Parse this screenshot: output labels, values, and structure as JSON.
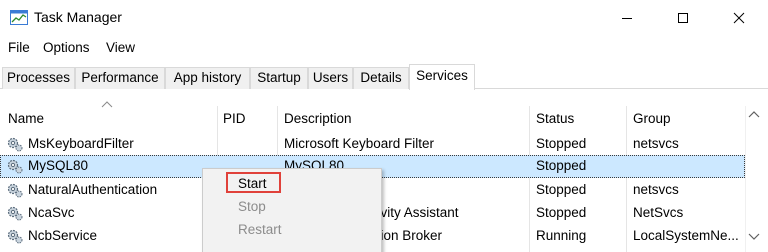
{
  "window": {
    "title": "Task Manager",
    "controls": {
      "minimize": "minimize-icon",
      "maximize": "maximize-icon",
      "close": "close-icon"
    }
  },
  "menu": [
    "File",
    "Options",
    "View"
  ],
  "tabs": [
    "Processes",
    "Performance",
    "App history",
    "Startup",
    "Users",
    "Details",
    "Services"
  ],
  "active_tab": "Services",
  "columns": [
    "Name",
    "PID",
    "Description",
    "Status",
    "Group"
  ],
  "rows": [
    {
      "name": "MsKeyboardFilter",
      "pid": "",
      "description": "Microsoft Keyboard Filter",
      "status": "Stopped",
      "group": "netsvcs"
    },
    {
      "name": "MySQL80",
      "pid": "",
      "description": "MySQL80",
      "status": "Stopped",
      "group": ""
    },
    {
      "name": "NaturalAuthentication",
      "pid": "",
      "description": "ication",
      "status": "Stopped",
      "group": "netsvcs"
    },
    {
      "name": "NcaSvc",
      "pid": "",
      "description": "ctivity Assistant",
      "status": "Stopped",
      "group": "NetSvcs"
    },
    {
      "name": "NcbService",
      "pid": "",
      "description": "ction Broker",
      "status": "Running",
      "group": "LocalSystemNe..."
    }
  ],
  "selected_row": "MySQL80",
  "context_menu": {
    "start": "Start",
    "stop": "Stop",
    "restart": "Restart"
  },
  "colors": {
    "selection": "#cce8ff",
    "highlight_box": "#e0413a",
    "disabled_text": "#8c8c8c"
  }
}
